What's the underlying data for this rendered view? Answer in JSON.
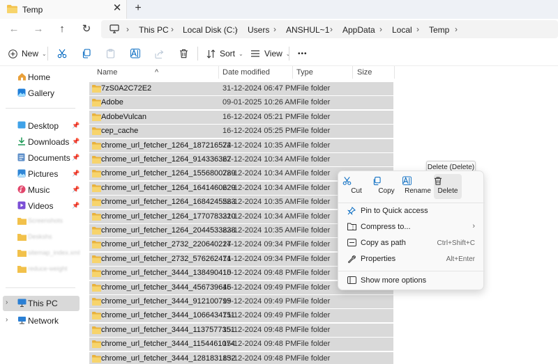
{
  "tab": {
    "title": "Temp",
    "close_glyph": "✕",
    "new_glyph": "+"
  },
  "address": {
    "crumbs": [
      "This PC",
      "Local Disk (C:)",
      "Users",
      "ANSHUL~1",
      "AppData",
      "Local",
      "Temp"
    ]
  },
  "commands": {
    "new_label": "New",
    "sort_label": "Sort",
    "view_label": "View",
    "more_label": "•••"
  },
  "sidebar": {
    "items": [
      {
        "label": "Home",
        "icon": "home-icon"
      },
      {
        "label": "Gallery",
        "icon": "gallery-icon"
      },
      {
        "label": "Desktop",
        "icon": "desktop-icon"
      },
      {
        "label": "Downloads",
        "icon": "downloads-icon"
      },
      {
        "label": "Documents",
        "icon": "documents-icon"
      },
      {
        "label": "Pictures",
        "icon": "pictures-icon"
      },
      {
        "label": "Music",
        "icon": "music-icon"
      },
      {
        "label": "Videos",
        "icon": "videos-icon"
      },
      {
        "label": "Screenshots",
        "icon": "folder-icon"
      },
      {
        "label": "Deskshs",
        "icon": "folder-icon"
      },
      {
        "label": "sitemap_index.xml",
        "icon": "folder-icon"
      },
      {
        "label": "reduce-weight",
        "icon": "folder-icon"
      },
      {
        "label": "This PC",
        "icon": "pc-icon"
      },
      {
        "label": "Network",
        "icon": "network-icon"
      }
    ]
  },
  "columns": {
    "name": "Name",
    "date": "Date modified",
    "type": "Type",
    "size": "Size"
  },
  "files": [
    {
      "name": "7zS0A2C72E2",
      "date": "31-12-2024 06:47 PM",
      "type": "File folder"
    },
    {
      "name": "Adobe",
      "date": "09-01-2025 10:26 AM",
      "type": "File folder"
    },
    {
      "name": "AdobeVulcan",
      "date": "16-12-2024 05:21 PM",
      "type": "File folder"
    },
    {
      "name": "cep_cache",
      "date": "16-12-2024 05:25 PM",
      "type": "File folder"
    },
    {
      "name": "chrome_url_fetcher_1264_187216574",
      "date": "22-12-2024 10:35 AM",
      "type": "File folder"
    },
    {
      "name": "chrome_url_fetcher_1264_914336367",
      "date": "22-12-2024 10:34 AM",
      "type": "File folder"
    },
    {
      "name": "chrome_url_fetcher_1264_1556800789",
      "date": "22-12-2024 10:34 AM",
      "type": "File folder"
    },
    {
      "name": "chrome_url_fetcher_1264_1641460629",
      "date": "22-12-2024 10:34 AM",
      "type": "File folder"
    },
    {
      "name": "chrome_url_fetcher_1264_1684245583",
      "date": "22-12-2024 10:35 AM",
      "type": "File folder"
    },
    {
      "name": "chrome_url_fetcher_1264_1770783310",
      "date": "22-12-2024 10:34 AM",
      "type": "File folder"
    },
    {
      "name": "chrome_url_fetcher_1264_2044533838",
      "date": "22-12-2024 10:35 AM",
      "type": "File folder"
    },
    {
      "name": "chrome_url_fetcher_2732_220640227",
      "date": "14-12-2024 09:34 PM",
      "type": "File folder"
    },
    {
      "name": "chrome_url_fetcher_2732_576262471",
      "date": "14-12-2024 09:34 PM",
      "type": "File folder"
    },
    {
      "name": "chrome_url_fetcher_3444_138490410",
      "date": "15-12-2024 09:48 PM",
      "type": "File folder"
    },
    {
      "name": "chrome_url_fetcher_3444_456739646",
      "date": "15-12-2024 09:49 PM",
      "type": "File folder"
    },
    {
      "name": "chrome_url_fetcher_3444_912100799",
      "date": "15-12-2024 09:49 PM",
      "type": "File folder"
    },
    {
      "name": "chrome_url_fetcher_3444_1066434711",
      "date": "15-12-2024 09:49 PM",
      "type": "File folder"
    },
    {
      "name": "chrome_url_fetcher_3444_1137577351",
      "date": "15-12-2024 09:48 PM",
      "type": "File folder"
    },
    {
      "name": "chrome_url_fetcher_3444_1154461074",
      "date": "15-12-2024 09:48 PM",
      "type": "File folder"
    },
    {
      "name": "chrome_url_fetcher_3444_1281831832",
      "date": "15-12-2024 09:48 PM",
      "type": "File folder"
    }
  ],
  "context_menu": {
    "quick": [
      {
        "label": "Cut",
        "icon": "scissors-icon"
      },
      {
        "label": "Copy",
        "icon": "copy-icon"
      },
      {
        "label": "Rename",
        "icon": "rename-icon"
      },
      {
        "label": "Delete",
        "icon": "trash-icon"
      }
    ],
    "items": [
      {
        "label": "Pin to Quick access",
        "shortcut": "",
        "icon": "pin-icon"
      },
      {
        "label": "Compress to...",
        "shortcut": "",
        "icon": "zip-icon",
        "submenu": "›"
      },
      {
        "label": "Copy as path",
        "shortcut": "Ctrl+Shift+C",
        "icon": "copy-path-icon"
      },
      {
        "label": "Properties",
        "shortcut": "Alt+Enter",
        "icon": "wrench-icon"
      },
      {
        "label": "Show more options",
        "shortcut": "",
        "icon": "more-options-icon"
      }
    ],
    "tooltip": "Delete (Delete)"
  },
  "colors": {
    "folder": "#f2c14b",
    "selection": "#d9d9d9",
    "accent": "#0067c0"
  }
}
